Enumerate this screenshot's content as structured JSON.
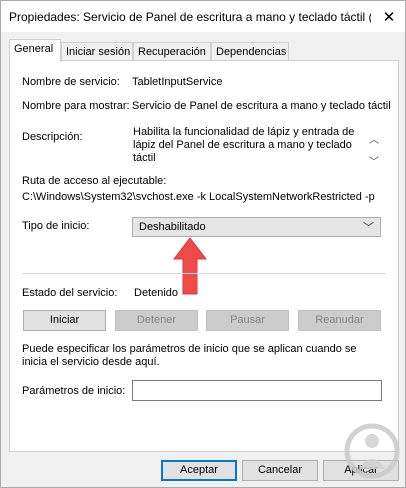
{
  "window": {
    "title": "Propiedades: Servicio de Panel de escritura a mano y teclado táctil (...",
    "close_glyph": "✕"
  },
  "tabs": [
    {
      "label": "General",
      "active": true
    },
    {
      "label": "Iniciar sesión",
      "active": false
    },
    {
      "label": "Recuperación",
      "active": false
    },
    {
      "label": "Dependencias",
      "active": false
    }
  ],
  "general": {
    "service_name_label": "Nombre de servicio:",
    "service_name_value": "TabletInputService",
    "display_name_label": "Nombre para mostrar:",
    "display_name_value": "Servicio de Panel de escritura a mano y teclado táctil",
    "description_label": "Descripción:",
    "description_value": "Habilita la funcionalidad de lápiz y entrada de lápiz del Panel de escritura a mano y teclado táctil",
    "path_label": "Ruta de acceso al ejecutable:",
    "path_value": "C:\\Windows\\System32\\svchost.exe -k LocalSystemNetworkRestricted -p",
    "startup_label": "Tipo de inicio:",
    "startup_value": "Deshabilitado",
    "status_label": "Estado del servicio:",
    "status_value": "Detenido",
    "buttons": {
      "start": "Iniciar",
      "stop": "Detener",
      "pause": "Pausar",
      "resume": "Reanudar"
    },
    "params_hint": "Puede especificar los parámetros de inicio que se aplican cuando se inicia el servicio desde aquí.",
    "params_label": "Parámetros de inicio:",
    "params_value": ""
  },
  "footer": {
    "ok": "Aceptar",
    "cancel": "Cancelar",
    "apply": "Aplicar"
  },
  "colors": {
    "arrow": "#ef4a4a",
    "focus": "#0078d7"
  }
}
